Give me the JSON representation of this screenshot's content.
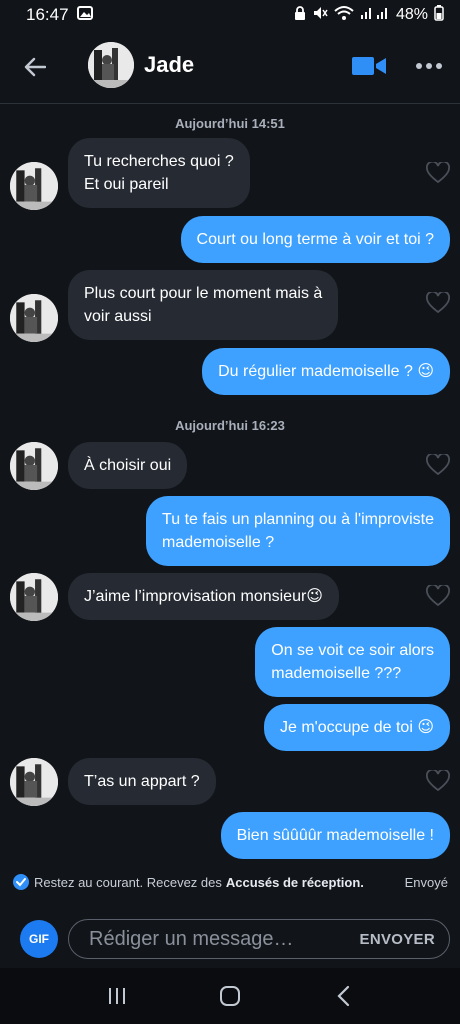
{
  "status_bar": {
    "time": "16:47",
    "battery": "48%"
  },
  "header": {
    "contact_name": "Jade"
  },
  "chat": {
    "timestamps": [
      "Aujourd’hui 14:51",
      "Aujourd’hui 16:23"
    ],
    "messages": [
      {
        "dir": "in",
        "lines": [
          "Tu recherches quoi ?",
          "Et oui pareil"
        ]
      },
      {
        "dir": "out",
        "lines": [
          "Court ou long terme à voir et toi ?"
        ]
      },
      {
        "dir": "in",
        "lines": [
          "Plus court pour le moment mais à",
          "voir aussi"
        ]
      },
      {
        "dir": "out",
        "lines": [
          "Du régulier mademoiselle ? 😉"
        ]
      },
      {
        "dir": "in",
        "lines": [
          "À choisir oui"
        ]
      },
      {
        "dir": "out",
        "lines": [
          "Tu te fais un planning ou à l'improviste",
          "mademoiselle ?"
        ]
      },
      {
        "dir": "in",
        "lines": [
          "J’aime l’improvisation monsieur😉"
        ]
      },
      {
        "dir": "out",
        "lines": [
          "On se voit ce soir alors",
          "mademoiselle ???"
        ]
      },
      {
        "dir": "out",
        "lines": [
          "Je m'occupe de toi 😉"
        ]
      },
      {
        "dir": "in",
        "lines": [
          "T’as un appart ?"
        ]
      },
      {
        "dir": "out",
        "lines": [
          "Bien sûûûûr mademoiselle !"
        ]
      }
    ]
  },
  "receipts": {
    "text": "Restez au courant. Recevez des",
    "bold": "Accusés de réception.",
    "status": "Envoyé"
  },
  "composer": {
    "gif_label": "GIF",
    "placeholder": "Rédiger un message…",
    "send_label": "ENVOYER"
  },
  "colors": {
    "outgoing": "#3ea1ff",
    "incoming": "#262a33",
    "background": "#111418"
  }
}
